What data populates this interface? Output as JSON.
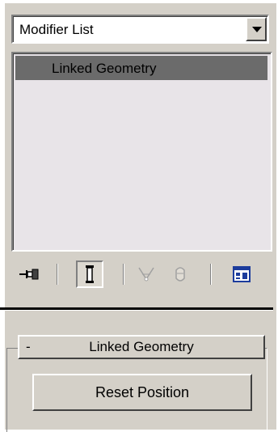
{
  "modifier_dropdown": {
    "selected": "Modifier List",
    "icon": "chevron-down-icon"
  },
  "stack": {
    "items": [
      {
        "label": "Linked Geometry",
        "selected": true
      }
    ]
  },
  "toolbar": {
    "tools": [
      {
        "name": "pin-stack-icon",
        "enabled": true
      },
      {
        "name": "show-end-result-icon",
        "enabled": true,
        "pressed": true
      },
      {
        "name": "make-unique-icon",
        "enabled": false
      },
      {
        "name": "remove-modifier-icon",
        "enabled": false
      },
      {
        "name": "configure-modifier-sets-icon",
        "enabled": true
      }
    ]
  },
  "rollout": {
    "toggle": "-",
    "title": "Linked Geometry",
    "reset_label": "Reset Position"
  },
  "colors": {
    "panel_bg": "#d4d0c8",
    "selected_item_bg": "#6b6b6b",
    "list_bg": "#e8e4e8",
    "accent_blue": "#1c3c9c"
  }
}
